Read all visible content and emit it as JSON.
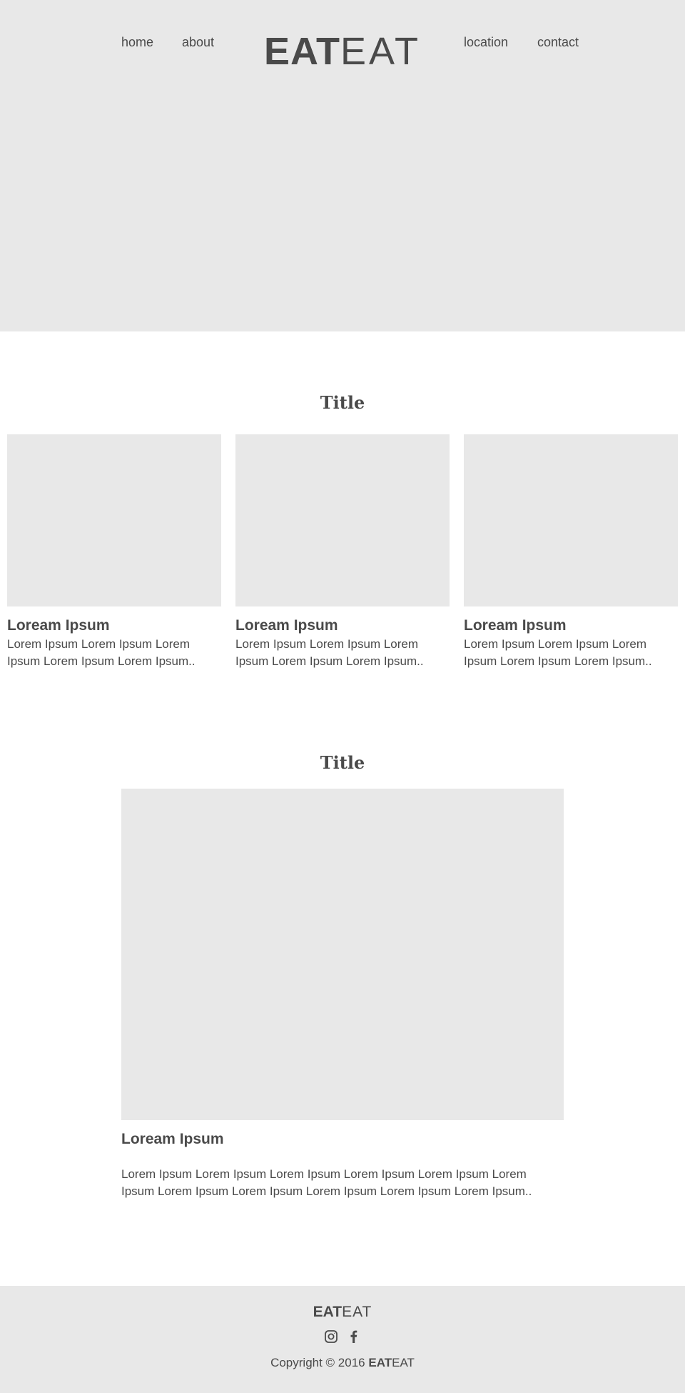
{
  "header": {
    "nav_left": [
      {
        "label": "home"
      },
      {
        "label": "about"
      }
    ],
    "nav_right": [
      {
        "label": "location"
      },
      {
        "label": "contact"
      }
    ],
    "logo_bold": "EAT",
    "logo_light": "EAT"
  },
  "section_one": {
    "title": "Title",
    "cards": [
      {
        "heading": "Loream Ipsum",
        "text": "Lorem Ipsum Lorem Ipsum Lorem Ipsum Lorem Ipsum Lorem Ipsum.."
      },
      {
        "heading": "Loream Ipsum",
        "text": "Lorem Ipsum Lorem Ipsum Lorem Ipsum Lorem Ipsum Lorem Ipsum.."
      },
      {
        "heading": "Loream Ipsum",
        "text": "Lorem Ipsum Lorem Ipsum Lorem Ipsum Lorem Ipsum Lorem Ipsum.."
      }
    ]
  },
  "section_two": {
    "title": "Title",
    "heading": "Loream Ipsum",
    "text": "Lorem Ipsum Lorem Ipsum Lorem Ipsum Lorem Ipsum Lorem Ipsum Lorem Ipsum Lorem Ipsum Lorem Ipsum Lorem Ipsum Lorem Ipsum Lorem Ipsum.."
  },
  "footer": {
    "logo_bold": "EAT",
    "logo_light": "EAT",
    "social_icons": [
      "instagram-icon",
      "facebook-icon"
    ],
    "copyright_prefix": "Copyright © 2016 ",
    "copyright_bold": "EAT",
    "copyright_light": "EAT"
  },
  "colors": {
    "placeholder_gray": "#e8e8e8",
    "text": "#4a4a4a",
    "background": "#ffffff"
  }
}
